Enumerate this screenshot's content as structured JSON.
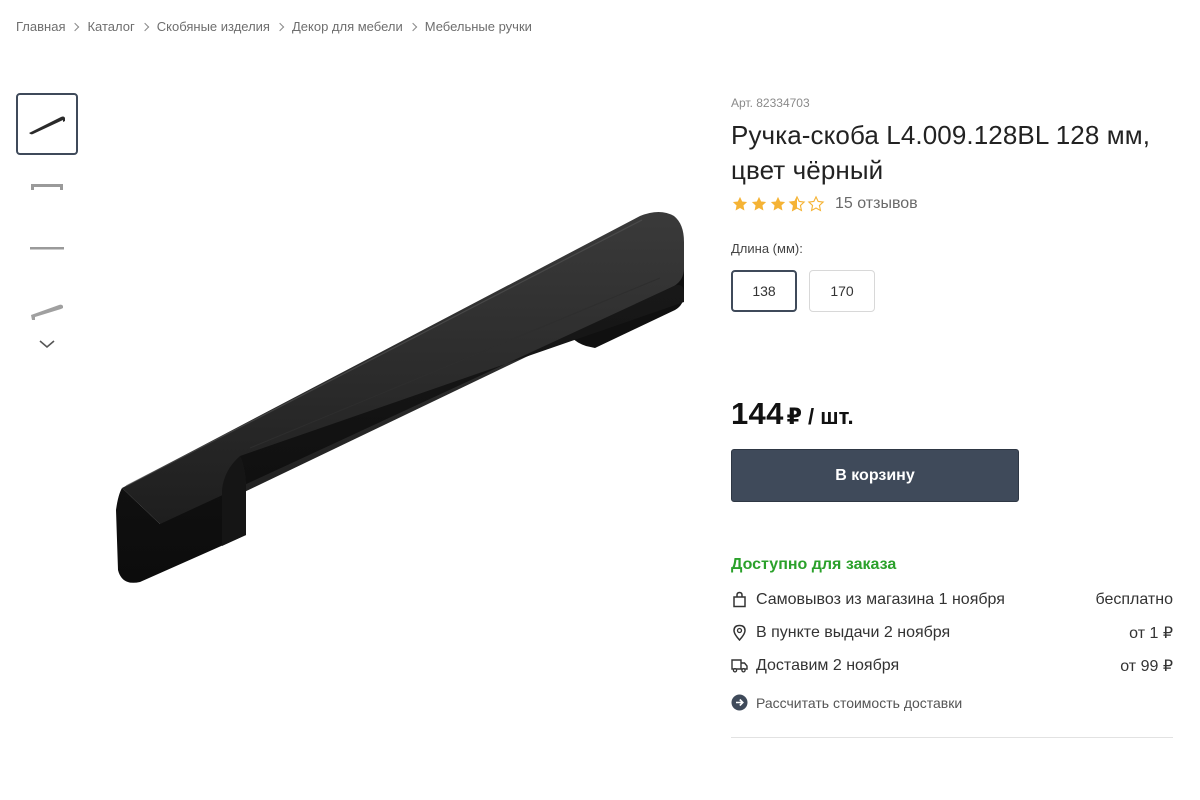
{
  "breadcrumb": [
    "Главная",
    "Каталог",
    "Скобяные изделия",
    "Декор для мебели",
    "Мебельные ручки"
  ],
  "product": {
    "sku": "Арт. 82334703",
    "title_line1": "Ручка-скоба L4.009.128BL 128 мм,",
    "title_line2": "цвет чёрный",
    "rating": 3.5,
    "rating_max": 5,
    "reviews": "15 отзывов"
  },
  "length": {
    "label": "Длина (мм):",
    "options": [
      "138",
      "170"
    ],
    "selected": "138"
  },
  "price": {
    "amount": "144",
    "unit": "₽ / шт."
  },
  "cart_button": "В корзину",
  "availability": "Доступно для заказа",
  "delivery": [
    {
      "icon": "shopping-bag-icon",
      "label": "Самовывоз из магазина 1 ноября",
      "price": "бесплатно"
    },
    {
      "icon": "map-pin-icon",
      "label": "В пункте выдачи 2 ноября",
      "price": "от 1 ₽"
    },
    {
      "icon": "delivery-truck-icon",
      "label": "Доставим 2 ноября",
      "price": "от 99 ₽"
    }
  ],
  "calc_delivery": "Рассчитать стоимость доставки",
  "colors": {
    "accent": "#3f4a5a",
    "available": "#2ba12b",
    "star": "#f5b335"
  }
}
